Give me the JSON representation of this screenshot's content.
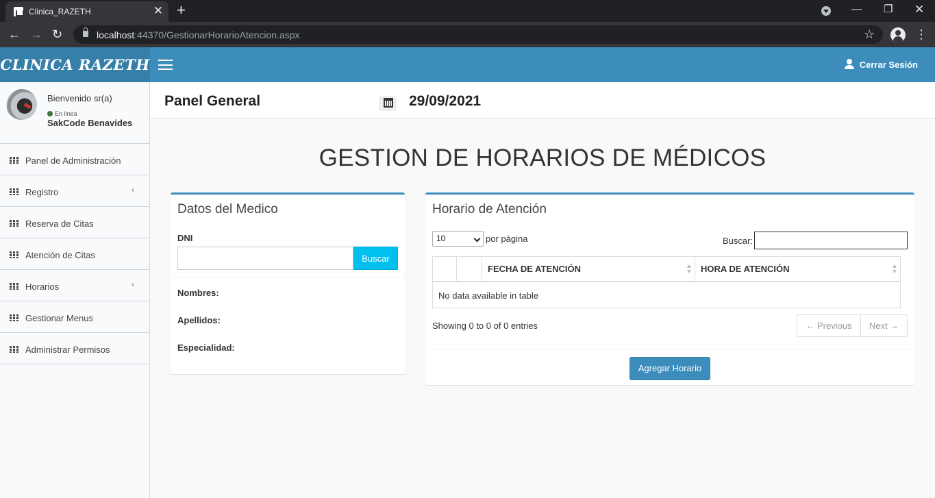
{
  "browser": {
    "tab_title": "Clinica_RAZETH",
    "url_host": "localhost",
    "url_path": ":44370/GestionarHorarioAtencion.aspx"
  },
  "header": {
    "logo": "CLINICA RAZETH",
    "logout": "Cerrar Sesión"
  },
  "user": {
    "welcome": "Bienvenido sr(a)",
    "status": "En linea",
    "name": "SakCode Benavides"
  },
  "sidebar": {
    "items": [
      {
        "label": "Panel de Administración",
        "has_submenu": false
      },
      {
        "label": "Registro",
        "has_submenu": true
      },
      {
        "label": "Reserva de Citas",
        "has_submenu": false
      },
      {
        "label": "Atención de Citas",
        "has_submenu": false
      },
      {
        "label": "Horarios",
        "has_submenu": true
      },
      {
        "label": "Gestionar Menus",
        "has_submenu": false
      },
      {
        "label": "Administrar Permisos",
        "has_submenu": false
      }
    ]
  },
  "content_header": {
    "title": "Panel General",
    "date": "29/09/2021"
  },
  "page": {
    "title": "GESTION DE HORARIOS DE MÉDICOS"
  },
  "doctor_box": {
    "title": "Datos del Medico",
    "dni_label": "DNI",
    "dni_value": "",
    "search_button": "Buscar",
    "fields": [
      "Nombres:",
      "Apellidos:",
      "Especialidad:"
    ]
  },
  "schedule_box": {
    "title": "Horario de Atención",
    "page_length": "10",
    "per_page_label": "por página",
    "search_label": "Buscar:",
    "search_value": "",
    "columns": [
      "",
      "",
      "FECHA DE ATENCIÓN",
      "HORA DE ATENCIÓN"
    ],
    "empty_message": "No data available in table",
    "info": "Showing 0 to 0 of 0 entries",
    "prev": "← Previous",
    "next": "Next →",
    "add_button": "Agregar Horario"
  },
  "colors": {
    "header_blue": "#3c8dbc",
    "logo_blue": "#367fa9",
    "info_button": "#00c0ef",
    "online_green": "#3c763d"
  }
}
